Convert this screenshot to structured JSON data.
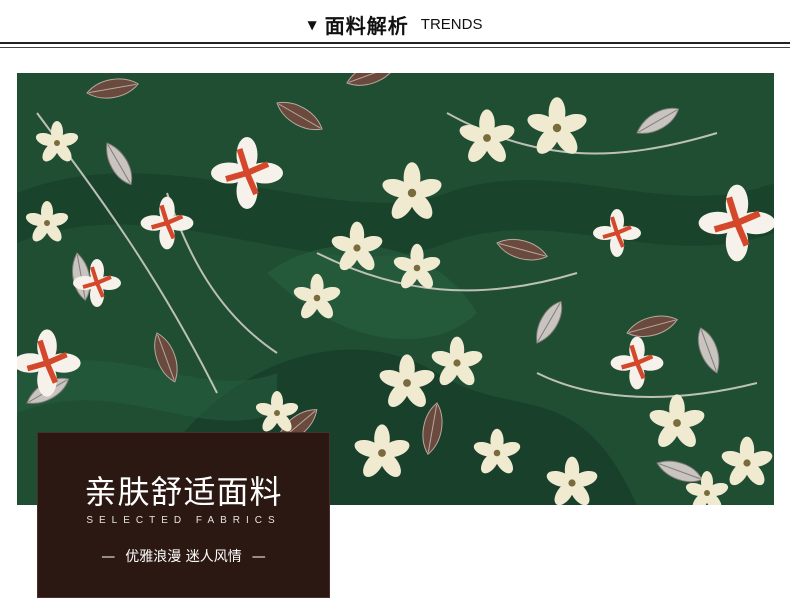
{
  "header": {
    "marker": "▼",
    "title_cn": "面料解析",
    "title_en": "TRENDS"
  },
  "card": {
    "headline": "亲肤舒适面料",
    "subtitle_en": "SELECTED FABRICS",
    "dash": "—",
    "tagline": "优雅浪漫 迷人风情"
  },
  "colors": {
    "fabric_green": "#1f4e33",
    "card_brown": "#2b1812",
    "petal_cream": "#f0ead1",
    "flower_red": "#d4472a",
    "leaf_brown": "#6b4a3e",
    "leaf_grey": "#c9c4c0"
  }
}
